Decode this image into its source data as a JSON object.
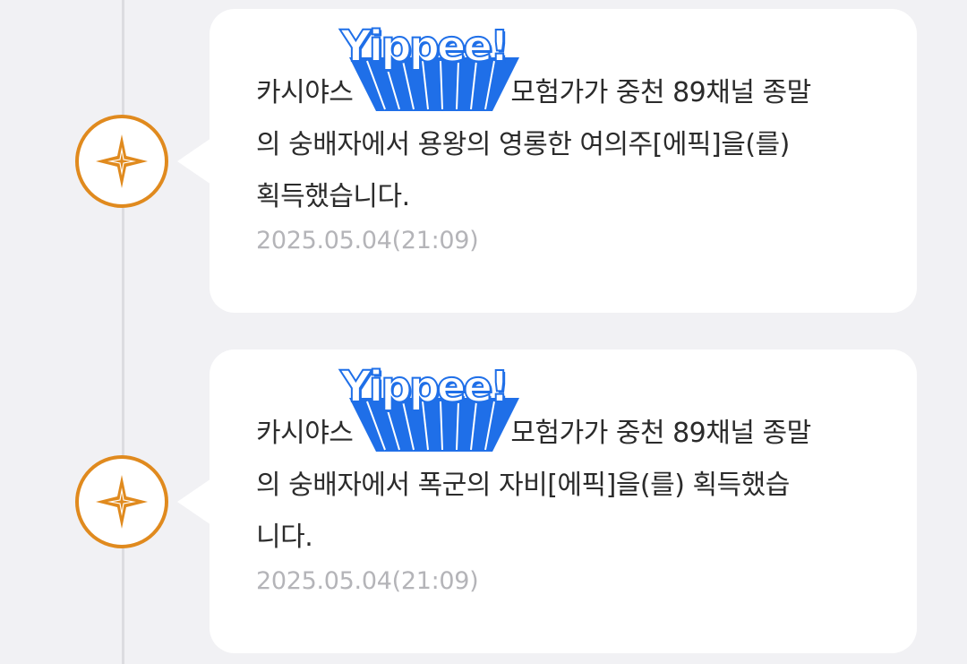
{
  "theme": {
    "accent": "#e08a1e",
    "sticker_blue": "#1f6fe8",
    "card_bg": "#ffffff",
    "page_bg": "#f1f1f4"
  },
  "entries": [
    {
      "icon": "compass-star-icon",
      "sticker_text": "Yippee!",
      "lines": [
        "카시야스",
        "모험가가 중천 89채널 종말",
        "의 숭배자에서 용왕의 영롱한 여의주[에픽]을(를)",
        "획득했습니다."
      ],
      "timestamp": "2025.05.04(21:09)"
    },
    {
      "icon": "compass-star-icon",
      "sticker_text": "Yippee!",
      "lines": [
        "카시야스",
        "모험가가 중천 89채널 종말",
        "의 숭배자에서 폭군의 자비[에픽]을(를) 획득했습",
        "니다."
      ],
      "timestamp": "2025.05.04(21:09)"
    }
  ]
}
